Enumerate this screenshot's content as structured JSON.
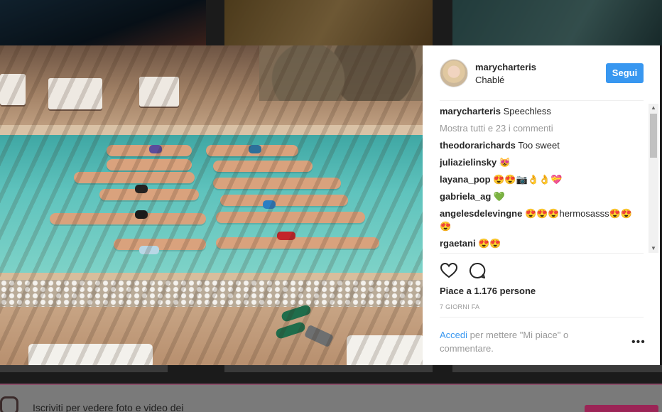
{
  "post": {
    "username": "marycharteris",
    "location": "Chablé",
    "follow_label": "Segui",
    "caption_user": "marycharteris",
    "caption_text": "Speechless",
    "view_all_comments": "Mostra tutti e 23 i commenti",
    "comments": [
      {
        "user": "theodorarichards",
        "text": "Too sweet"
      },
      {
        "user": "juliazielinsky",
        "text": "😻"
      },
      {
        "user": "layana_pop",
        "text": "😍😍📷👌👌💝"
      },
      {
        "user": "gabriela_ag",
        "text": "💚"
      },
      {
        "user": "angelesdelevingne",
        "text": "😍😍😍hermosasss😍😍😍"
      },
      {
        "user": "rgaetani",
        "text": "😍😍"
      }
    ],
    "likes": "Piace a 1.176 persone",
    "time": "7 GIORNI FA",
    "login_link": "Accedi",
    "login_rest": "per mettere \"Mi piace\" o commentare.",
    "more_icon": "•••"
  },
  "signup_bar": {
    "text": "Iscriviti per vedere foto e video dei"
  },
  "icons": {
    "like": "heart-icon",
    "comment": "comment-icon",
    "more": "more-options-icon"
  },
  "colors": {
    "accent": "#3897f0",
    "brand_bar": "#9b2456"
  }
}
